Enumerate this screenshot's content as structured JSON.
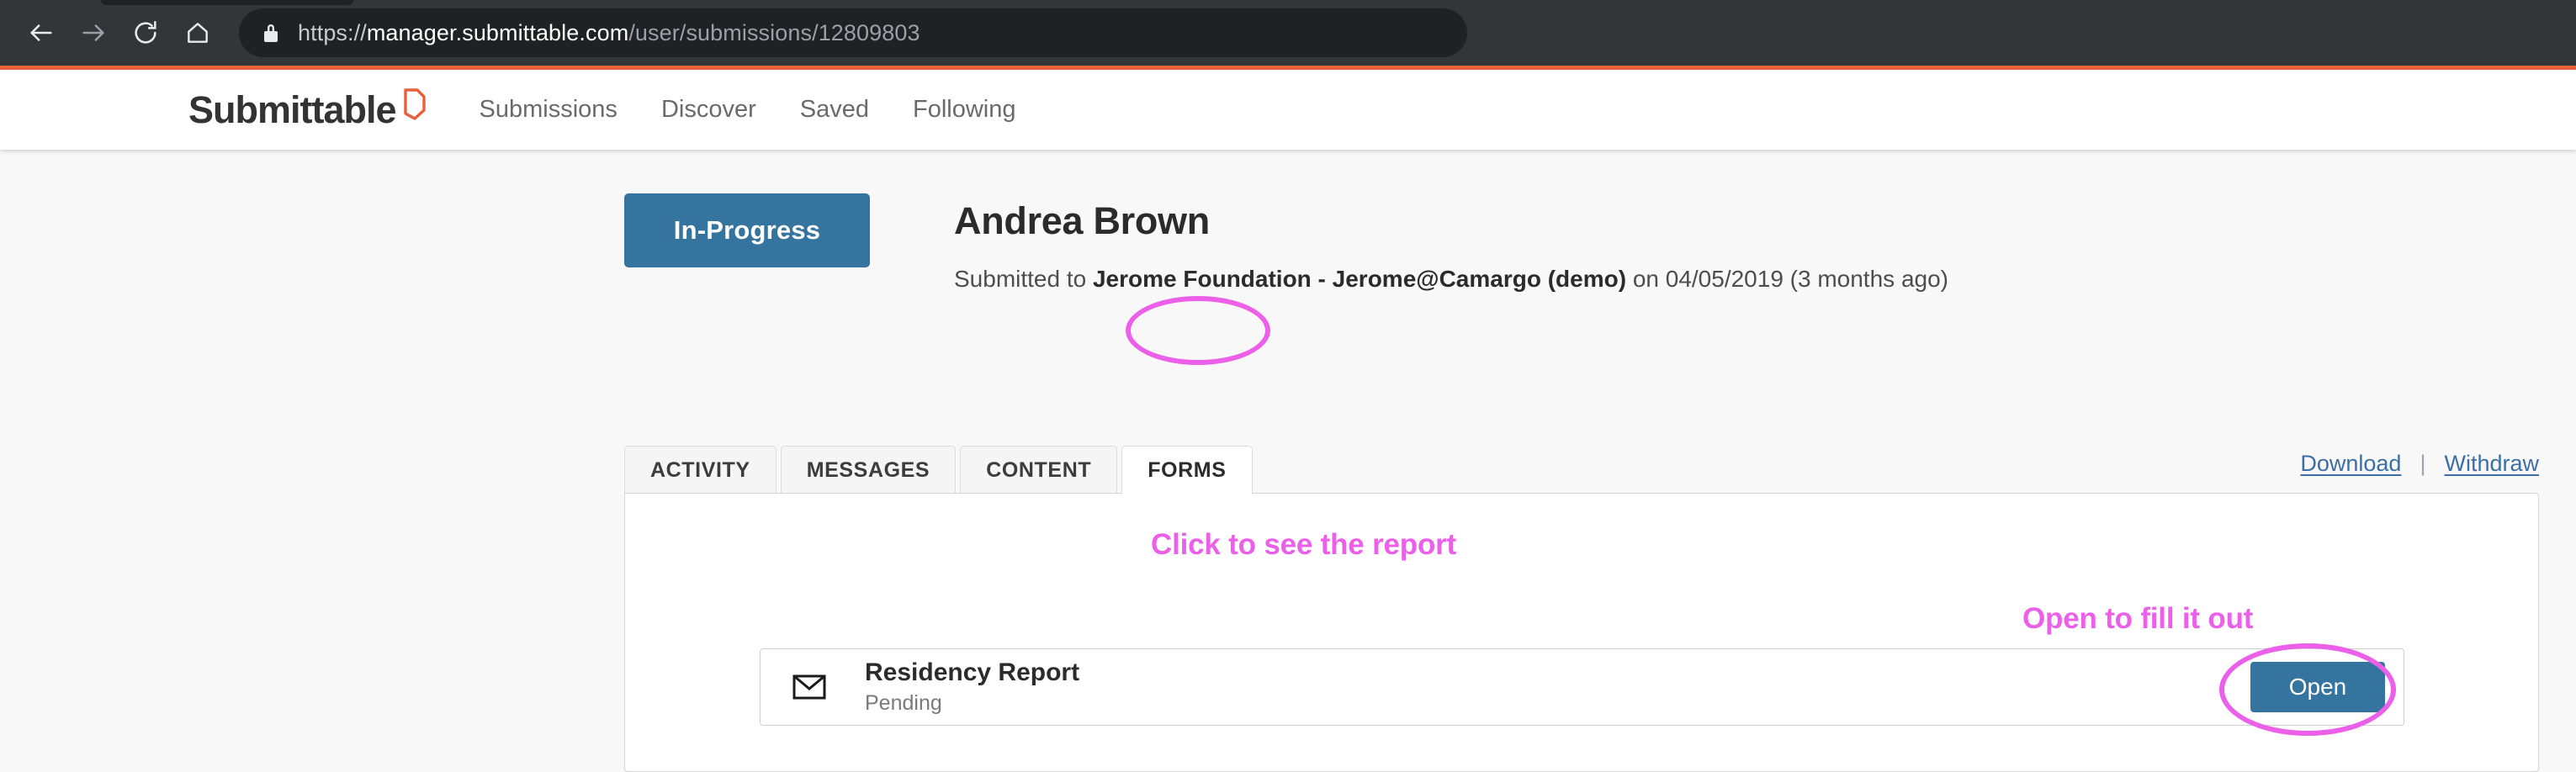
{
  "browser": {
    "back_icon": "back-arrow-icon",
    "forward_icon": "forward-arrow-icon",
    "reload_icon": "reload-icon",
    "home_icon": "home-icon",
    "lock_icon": "lock-icon",
    "url_scheme": "https://",
    "url_host": "manager.submittable.com",
    "url_path": "/user/submissions/12809803",
    "accent_color": "#e8613a"
  },
  "header": {
    "brand": "Submittable",
    "brand_mark": "submittable-logo-mark",
    "nav": [
      {
        "label": "Submissions"
      },
      {
        "label": "Discover"
      },
      {
        "label": "Saved"
      },
      {
        "label": "Following"
      }
    ]
  },
  "submission": {
    "status": "In-Progress",
    "status_color": "#35749f",
    "title": "Andrea Brown",
    "meta_prefix": "Submitted to ",
    "meta_org": "Jerome Foundation - Jerome@Camargo (demo)",
    "meta_suffix": " on 04/05/2019 (3 months ago)"
  },
  "tabs": [
    {
      "label": "ACTIVITY",
      "active": false
    },
    {
      "label": "MESSAGES",
      "active": false
    },
    {
      "label": "CONTENT",
      "active": false
    },
    {
      "label": "FORMS",
      "active": true
    }
  ],
  "actions": {
    "download": "Download",
    "separator": "|",
    "withdraw": "Withdraw"
  },
  "forms_panel": {
    "row": {
      "icon": "envelope-icon",
      "title": "Residency Report",
      "status": "Pending",
      "button_label": "Open"
    }
  },
  "annotations": {
    "color": "#ec5fe9",
    "forms_note": "Click to see the report",
    "open_note": "Open to fill it out"
  }
}
